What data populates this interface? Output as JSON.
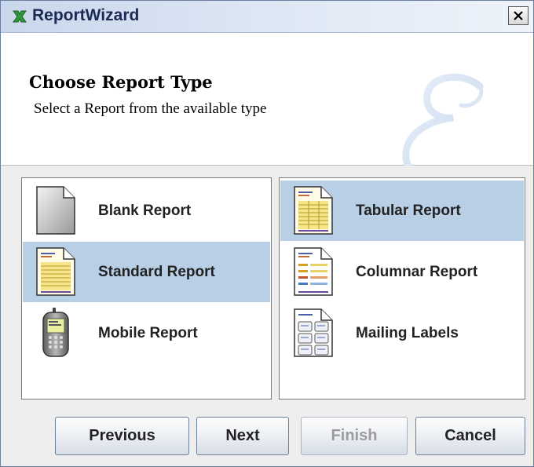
{
  "window": {
    "title": "ReportWizard"
  },
  "header": {
    "title": "Choose Report Type",
    "subtitle": "Select a Report from the available type"
  },
  "left_list": [
    {
      "label": "Blank Report",
      "icon": "blank-report-icon",
      "selected": false
    },
    {
      "label": "Standard Report",
      "icon": "standard-report-icon",
      "selected": true
    },
    {
      "label": "Mobile Report",
      "icon": "mobile-report-icon",
      "selected": false
    }
  ],
  "right_list": [
    {
      "label": "Tabular Report",
      "icon": "tabular-report-icon",
      "selected": true
    },
    {
      "label": "Columnar Report",
      "icon": "columnar-report-icon",
      "selected": false
    },
    {
      "label": "Mailing Labels",
      "icon": "mailing-labels-icon",
      "selected": false
    }
  ],
  "buttons": {
    "previous": "Previous",
    "next": "Next",
    "finish": "Finish",
    "cancel": "Cancel"
  },
  "colors": {
    "selection": "#b8cfe5",
    "titlebar_text": "#1a2a55",
    "disabled_text": "#9b9b9b"
  }
}
